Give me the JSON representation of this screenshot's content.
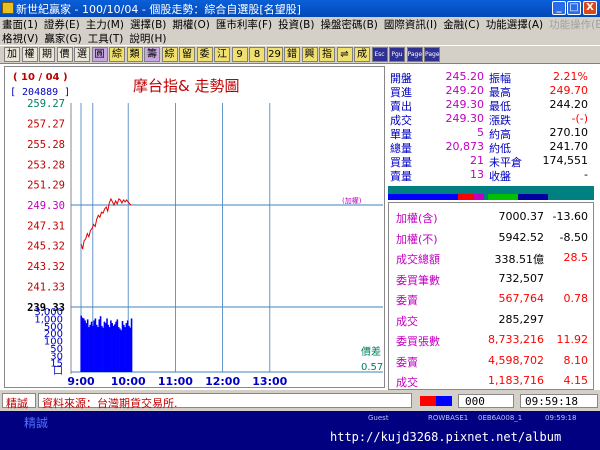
{
  "window": {
    "title": "新世紀贏家 - 100/10/04 - 個股走勢：綜合自選股[名望股]",
    "min": "_",
    "max": "□",
    "close": "X"
  },
  "menu": {
    "row1": [
      "畫面(1)",
      "證券(E)",
      "主力(M)",
      "選擇(B)",
      "期權(O)",
      "匯市利率(F)",
      "投資(B)",
      "操盤密碼(B)",
      "國際資訊(I)",
      "金融(C)",
      "功能選擇(A)"
    ],
    "row1_disabled": [
      "功能操作(E)"
    ],
    "row2": [
      "格視(V)",
      "贏家(G)",
      "工具(T)",
      "說明(H)"
    ]
  },
  "toolbar": {
    "buttons": [
      "加",
      "權",
      "期",
      "價",
      "選",
      "圓",
      "綜",
      "類",
      "籌",
      "綜",
      "留",
      "委",
      "江",
      "9",
      "8",
      "29",
      "錯",
      "興",
      "指",
      "⇌",
      "成",
      "Esc",
      "Pgu",
      "Page",
      "Page"
    ]
  },
  "chart_header": {
    "date": "( 10 / 04 )",
    "volume": "[ 204889 ]",
    "title": "摩台指&  走勢圖"
  },
  "chart_data": {
    "type": "line",
    "title": "摩台指& 走勢圖",
    "y_ticks": [
      "259.27",
      "257.27",
      "255.28",
      "253.28",
      "251.29",
      "249.30",
      "247.31",
      "245.32",
      "243.32",
      "241.33",
      "239.33"
    ],
    "ylim": [
      239.33,
      259.27
    ],
    "reference": 249.3,
    "reference_label": "(加權)",
    "x_ticks": [
      "9:00",
      "10:00",
      "11:00",
      "12:00",
      "13:00"
    ],
    "price_series": [
      {
        "t": 0,
        "v": 245.5
      },
      {
        "t": 2,
        "v": 245.0
      },
      {
        "t": 4,
        "v": 245.8
      },
      {
        "t": 6,
        "v": 246.0
      },
      {
        "t": 8,
        "v": 246.5
      },
      {
        "t": 10,
        "v": 246.2
      },
      {
        "t": 12,
        "v": 246.8
      },
      {
        "t": 14,
        "v": 247.0
      },
      {
        "t": 16,
        "v": 247.4
      },
      {
        "t": 18,
        "v": 247.2
      },
      {
        "t": 20,
        "v": 247.9
      },
      {
        "t": 22,
        "v": 248.3
      },
      {
        "t": 24,
        "v": 248.1
      },
      {
        "t": 26,
        "v": 248.6
      },
      {
        "t": 28,
        "v": 248.5
      },
      {
        "t": 30,
        "v": 248.9
      },
      {
        "t": 32,
        "v": 249.1
      },
      {
        "t": 34,
        "v": 248.7
      },
      {
        "t": 36,
        "v": 249.5
      },
      {
        "t": 38,
        "v": 249.9
      },
      {
        "t": 40,
        "v": 249.6
      },
      {
        "t": 42,
        "v": 249.3
      },
      {
        "t": 44,
        "v": 249.7
      },
      {
        "t": 46,
        "v": 249.4
      },
      {
        "t": 48,
        "v": 249.9
      },
      {
        "t": 50,
        "v": 249.8
      },
      {
        "t": 52,
        "v": 249.5
      },
      {
        "t": 54,
        "v": 249.8
      },
      {
        "t": 56,
        "v": 249.6
      },
      {
        "t": 58,
        "v": 249.8
      },
      {
        "t": 60,
        "v": 249.6
      },
      {
        "t": 62,
        "v": 249.4
      },
      {
        "t": 64,
        "v": 249.3
      }
    ],
    "volume_ticks": [
      "3,000",
      "1,000",
      "500",
      "200",
      "100",
      "50",
      "30",
      "15",
      "口"
    ],
    "volume_series": [
      1300,
      1000,
      900,
      700,
      500,
      800,
      300,
      400,
      600,
      350,
      700,
      900,
      400,
      300,
      800,
      1200,
      350,
      280,
      600,
      500,
      900,
      400,
      300,
      700,
      500,
      350,
      420,
      600,
      800,
      300,
      250,
      200,
      650,
      400,
      300,
      500,
      700,
      350,
      280,
      900
    ],
    "x_range_minutes": [
      0,
      300
    ],
    "diff_label": "價差",
    "diff_value": "0.57"
  },
  "quote": {
    "rows": [
      {
        "l1": "開盤",
        "v1": "245.20",
        "l2": "振幅",
        "v2": "2.21%",
        "c2": "#ff0000"
      },
      {
        "l1": "買進",
        "v1": "249.20",
        "l2": "最高",
        "v2": "249.70",
        "c2": "#ff0000"
      },
      {
        "l1": "賣出",
        "v1": "249.30",
        "l2": "最低",
        "v2": "244.20",
        "c2": "#000000"
      },
      {
        "l1": "成交",
        "v1": "249.30",
        "l2": "漲跌",
        "v2": "-(-)",
        "c2": "#ff0000"
      },
      {
        "l1": "單量",
        "v1": "5",
        "l2": "約高",
        "v2": "270.10",
        "c2": "#000000"
      },
      {
        "l1": "總量",
        "v1": "20,873",
        "l2": "約低",
        "v2": "241.70",
        "c2": "#000000"
      },
      {
        "l1": "買量",
        "v1": "21",
        "l2": "未平倉",
        "v2": "174,551",
        "c2": "#000000"
      },
      {
        "l1": "賣量",
        "v1": "13",
        "l2": "收盤",
        "v2": "-",
        "c2": "#000000"
      }
    ],
    "stats": [
      {
        "label": "加權(含)",
        "value": "7000.37",
        "change": "-13.60",
        "vcolor": "#000000",
        "ccolor": "#000000"
      },
      {
        "label": "加權(不)",
        "value": "5942.52",
        "change": "-8.50",
        "vcolor": "#000000",
        "ccolor": "#000000"
      },
      {
        "label": "成交總額",
        "value": "338.51億",
        "change": "28.5",
        "vcolor": "#000000",
        "ccolor": "#ff0000"
      },
      {
        "label": "委買筆數",
        "value": "732,507",
        "change": "",
        "vcolor": "#000000",
        "ccolor": "#000000"
      },
      {
        "label": "委賣",
        "value": "567,764",
        "change": "0.78",
        "vcolor": "#ff0000",
        "ccolor": "#ff0000"
      },
      {
        "label": "成交",
        "value": "285,297",
        "change": "",
        "vcolor": "#000000",
        "ccolor": "#000000"
      },
      {
        "label": "委買張數",
        "value": "8,733,216",
        "change": "11.92",
        "vcolor": "#ff0000",
        "ccolor": "#ff0000"
      },
      {
        "label": "委賣",
        "value": "4,598,702",
        "change": "8.10",
        "vcolor": "#ff0000",
        "ccolor": "#ff0000"
      },
      {
        "label": "成交",
        "value": "1,183,716",
        "change": "4.15",
        "vcolor": "#ff0000",
        "ccolor": "#ff0000"
      }
    ]
  },
  "status": {
    "tag": "精誠",
    "message": "資料來源：台灣期貨交易所.",
    "code": "000",
    "time": "09:59:18"
  },
  "footer": {
    "brand": "精誠",
    "labels": [
      "Guest",
      "ROWBASE1",
      "0EB6A008_1",
      "09:59:18"
    ],
    "url": "http://kujd3268.pixnet.net/album"
  }
}
